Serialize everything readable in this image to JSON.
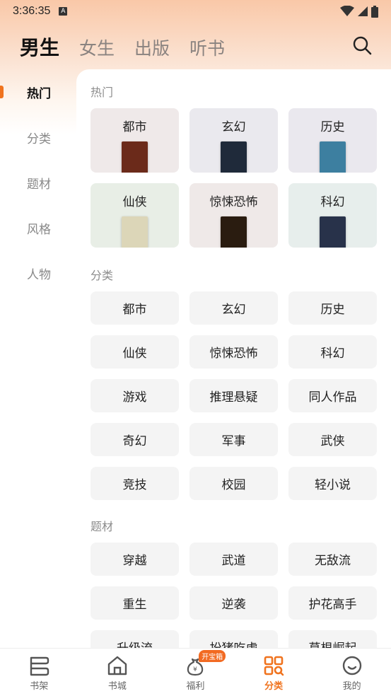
{
  "status_bar": {
    "time": "3:36:35",
    "notification_icon": "A"
  },
  "top_tabs": [
    {
      "label": "男生",
      "active": true
    },
    {
      "label": "女生",
      "active": false
    },
    {
      "label": "出版",
      "active": false
    },
    {
      "label": "听书",
      "active": false
    }
  ],
  "sidebar": {
    "items": [
      {
        "label": "热门",
        "active": true
      },
      {
        "label": "分类",
        "active": false
      },
      {
        "label": "题材",
        "active": false
      },
      {
        "label": "风格",
        "active": false
      },
      {
        "label": "人物",
        "active": false
      }
    ]
  },
  "hot": {
    "title": "热门",
    "cards": [
      {
        "label": "都市",
        "bg": "#efe9e9",
        "cover": "#6b2a1a"
      },
      {
        "label": "玄幻",
        "bg": "#eae9ee",
        "cover": "#1f2a3a"
      },
      {
        "label": "历史",
        "bg": "#eae8ee",
        "cover": "#3d7fa0"
      },
      {
        "label": "仙侠",
        "bg": "#e8eee6",
        "cover": "#dcd6b8"
      },
      {
        "label": "惊悚恐怖",
        "bg": "#efe9e8",
        "cover": "#2a1c10"
      },
      {
        "label": "科幻",
        "bg": "#e7eeec",
        "cover": "#28324a"
      }
    ]
  },
  "categories": {
    "title": "分类",
    "items": [
      "都市",
      "玄幻",
      "历史",
      "仙侠",
      "惊悚恐怖",
      "科幻",
      "游戏",
      "推理悬疑",
      "同人作品",
      "奇幻",
      "军事",
      "武侠",
      "竞技",
      "校园",
      "轻小说"
    ]
  },
  "themes": {
    "title": "题材",
    "items": [
      "穿越",
      "武道",
      "无敌流",
      "重生",
      "逆袭",
      "护花高手",
      "升级流",
      "扮猪吃虎",
      "草根崛起"
    ]
  },
  "bottom_nav": {
    "items": [
      {
        "label": "书架",
        "icon": "bookshelf-icon",
        "active": false
      },
      {
        "label": "书城",
        "icon": "home-icon",
        "active": false
      },
      {
        "label": "福利",
        "icon": "money-bag-icon",
        "active": false,
        "badge": "开宝箱"
      },
      {
        "label": "分类",
        "icon": "category-grid-icon",
        "active": true
      },
      {
        "label": "我的",
        "icon": "profile-icon",
        "active": false
      }
    ]
  },
  "colors": {
    "accent": "#f0731e"
  }
}
